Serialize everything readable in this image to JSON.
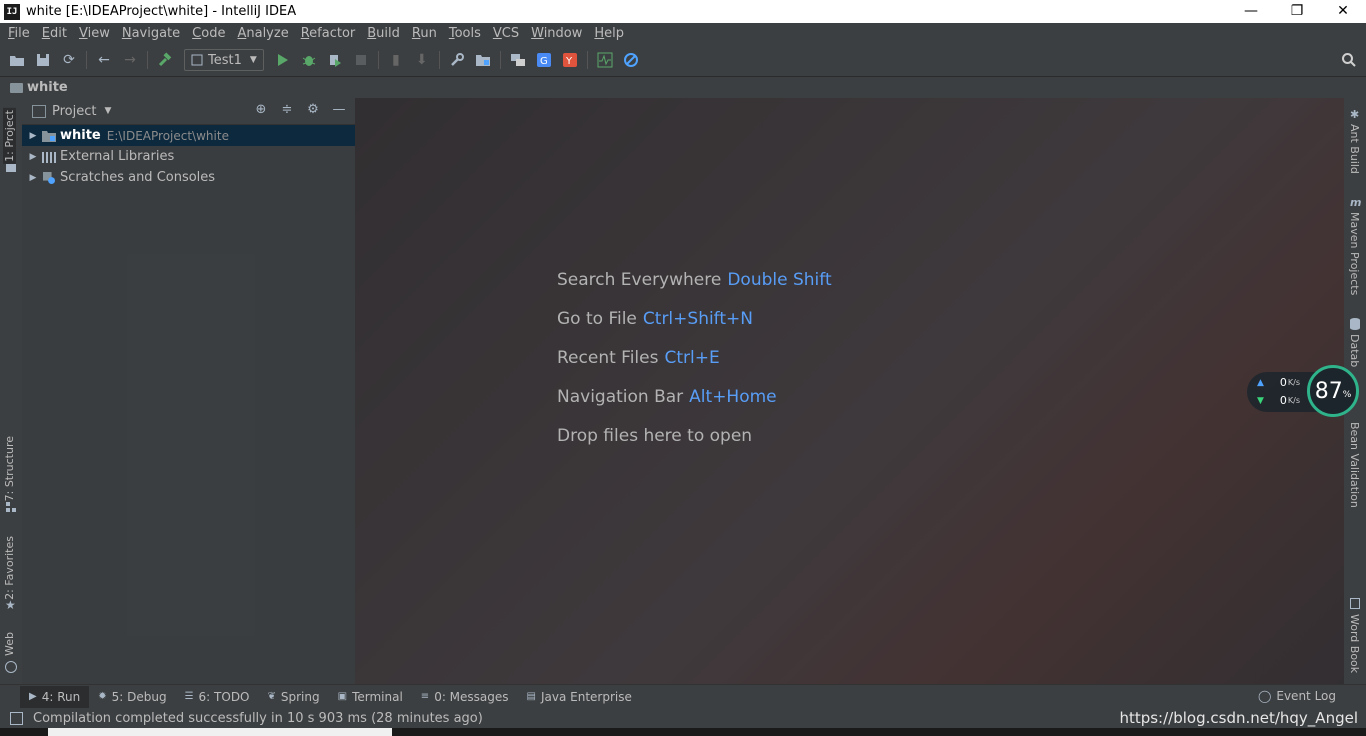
{
  "window": {
    "title": "white [E:\\IDEAProject\\white] - IntelliJ IDEA",
    "app_icon": "IJ",
    "controls": {
      "minimize": "—",
      "restore": "❐",
      "close": "✕"
    }
  },
  "menu": [
    "File",
    "Edit",
    "View",
    "Navigate",
    "Code",
    "Analyze",
    "Refactor",
    "Build",
    "Run",
    "Tools",
    "VCS",
    "Window",
    "Help"
  ],
  "toolbar": {
    "run_config": "Test1"
  },
  "breadcrumb": {
    "root": "white"
  },
  "project_panel": {
    "title": "Project",
    "tree": [
      {
        "label": "white",
        "path": "E:\\IDEAProject\\white",
        "selected": true
      },
      {
        "label": "External Libraries"
      },
      {
        "label": "Scratches and Consoles"
      }
    ]
  },
  "left_tabs": {
    "project": "1: Project",
    "structure": "7: Structure",
    "favorites": "2: Favorites",
    "web": "Web"
  },
  "right_tabs": {
    "ant": "Ant Build",
    "maven": "Maven Projects",
    "database": "Datab",
    "bean": "Bean Validation",
    "word": "Word Book"
  },
  "editor_hints": [
    {
      "text": "Search Everywhere",
      "key": "Double Shift"
    },
    {
      "text": "Go to File",
      "key": "Ctrl+Shift+N"
    },
    {
      "text": "Recent Files",
      "key": "Ctrl+E"
    },
    {
      "text": "Navigation Bar",
      "key": "Alt+Home"
    },
    {
      "text": "Drop files here to open",
      "key": ""
    }
  ],
  "net_widget": {
    "up": "0",
    "down": "0",
    "unit": "K/s",
    "percent": "87",
    "percent_sign": "%"
  },
  "bottom_tabs": [
    {
      "label": "4: Run",
      "active": true
    },
    {
      "label": "5: Debug"
    },
    {
      "label": "6: TODO"
    },
    {
      "label": "Spring"
    },
    {
      "label": "Terminal"
    },
    {
      "label": "0: Messages"
    },
    {
      "label": "Java Enterprise"
    }
  ],
  "event_log": "Event Log",
  "status": {
    "message": "Compilation completed successfully in 10 s 903 ms (28 minutes ago)",
    "watermark": "https://blog.csdn.net/hqy_Angel"
  }
}
